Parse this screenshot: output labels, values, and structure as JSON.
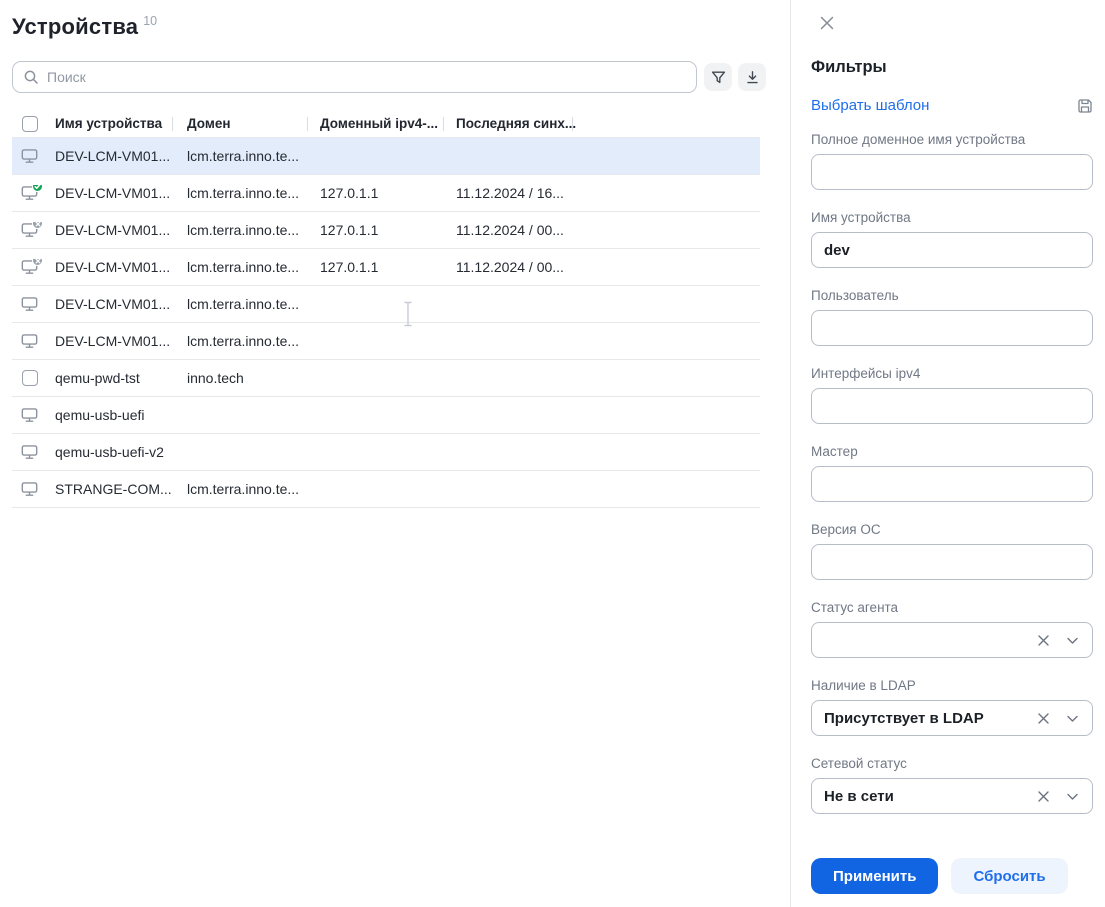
{
  "page": {
    "title": "Устройства",
    "count": "10"
  },
  "toolbar": {
    "search_placeholder": "Поиск",
    "icons": {
      "search": "search-icon",
      "filter": "funnel-icon",
      "export": "download-icon"
    }
  },
  "table": {
    "columns": [
      "Имя устройства",
      "Домен",
      "Доменный ipv4-...",
      "Последняя синх..."
    ],
    "rows": [
      {
        "icon": "monitor-icon",
        "name": "DEV-LCM-VM01...",
        "domain": "lcm.terra.inno.te...",
        "ip": "",
        "sync": "",
        "selected": true
      },
      {
        "icon": "monitor-online-icon",
        "name": "DEV-LCM-VM01...",
        "domain": "lcm.terra.inno.te...",
        "ip": "127.0.1.1",
        "sync": "11.12.2024 / 16...",
        "selected": false
      },
      {
        "icon": "monitor-offline-icon",
        "name": "DEV-LCM-VM01...",
        "domain": "lcm.terra.inno.te...",
        "ip": "127.0.1.1",
        "sync": "11.12.2024 / 00...",
        "selected": false
      },
      {
        "icon": "monitor-offline-icon",
        "name": "DEV-LCM-VM01...",
        "domain": "lcm.terra.inno.te...",
        "ip": "127.0.1.1",
        "sync": "11.12.2024 / 00...",
        "selected": false
      },
      {
        "icon": "monitor-icon",
        "name": "DEV-LCM-VM01...",
        "domain": "lcm.terra.inno.te...",
        "ip": "",
        "sync": "",
        "selected": false
      },
      {
        "icon": "monitor-icon",
        "name": "DEV-LCM-VM01...",
        "domain": "lcm.terra.inno.te...",
        "ip": "",
        "sync": "",
        "selected": false
      },
      {
        "icon": "checkbox",
        "name": "qemu-pwd-tst",
        "domain": "inno.tech",
        "ip": "",
        "sync": "",
        "selected": false
      },
      {
        "icon": "monitor-icon",
        "name": "qemu-usb-uefi",
        "domain": "",
        "ip": "",
        "sync": "",
        "selected": false
      },
      {
        "icon": "monitor-icon",
        "name": "qemu-usb-uefi-v2",
        "domain": "",
        "ip": "",
        "sync": "",
        "selected": false
      },
      {
        "icon": "monitor-icon",
        "name": "STRANGE-COM...",
        "domain": "lcm.terra.inno.te...",
        "ip": "",
        "sync": "",
        "selected": false
      }
    ]
  },
  "filters": {
    "title": "Фильтры",
    "template_link": "Выбрать шаблон",
    "save_icon": "floppy-save-icon",
    "close_icon": "close-icon",
    "fields": [
      {
        "label": "Полное доменное имя устройства",
        "value": "",
        "type": "text"
      },
      {
        "label": "Имя устройства",
        "value": "dev",
        "type": "text"
      },
      {
        "label": "Пользователь",
        "value": "",
        "type": "text"
      },
      {
        "label": "Интерфейсы ipv4",
        "value": "",
        "type": "text"
      },
      {
        "label": "Мастер",
        "value": "",
        "type": "text"
      },
      {
        "label": "Версия ОС",
        "value": "",
        "type": "text"
      },
      {
        "label": "Статус агента",
        "value": "",
        "type": "select"
      },
      {
        "label": "Наличие в LDAP",
        "value": "Присутствует в LDAP",
        "type": "select"
      },
      {
        "label": "Сетевой статус",
        "value": "Не в сети",
        "type": "select"
      }
    ],
    "apply_label": "Применить",
    "reset_label": "Сбросить"
  },
  "colors": {
    "accent_blue": "#1165e3",
    "link_blue": "#1f6fea",
    "selected_row_bg": "#e2ecfa",
    "online_badge": "#12a454",
    "offline_badge": "#98a0aa",
    "secondary_btn_bg": "#eef4fd"
  }
}
